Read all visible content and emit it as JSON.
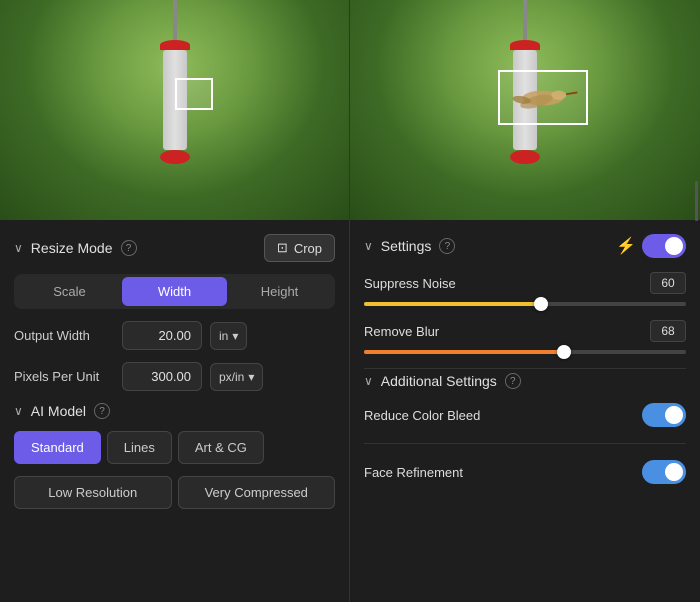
{
  "left": {
    "resize_mode_label": "Resize Mode",
    "crop_label": "Crop",
    "tab_scale": "Scale",
    "tab_width": "Width",
    "tab_height": "Height",
    "active_tab": "Width",
    "output_width_label": "Output Width",
    "output_width_value": "20.00",
    "output_width_unit": "in",
    "pixels_per_unit_label": "Pixels Per Unit",
    "pixels_per_unit_value": "300.00",
    "pixels_per_unit_unit": "px/in",
    "ai_model_label": "AI Model",
    "model_standard": "Standard",
    "model_lines": "Lines",
    "model_art_cg": "Art & CG",
    "model_low_res": "Low Resolution",
    "model_compressed": "Very Compressed"
  },
  "right": {
    "settings_label": "Settings",
    "suppress_noise_label": "Suppress Noise",
    "suppress_noise_value": "60",
    "suppress_noise_pct": 55,
    "remove_blur_label": "Remove Blur",
    "remove_blur_value": "68",
    "remove_blur_pct": 62,
    "additional_settings_label": "Additional Settings",
    "reduce_color_bleed_label": "Reduce Color Bleed",
    "face_refinement_label": "Face Refinement"
  },
  "icons": {
    "chevron": "›",
    "help": "?",
    "lightning": "⚡",
    "crop_icon": "⊡",
    "chevron_down": "∨"
  }
}
